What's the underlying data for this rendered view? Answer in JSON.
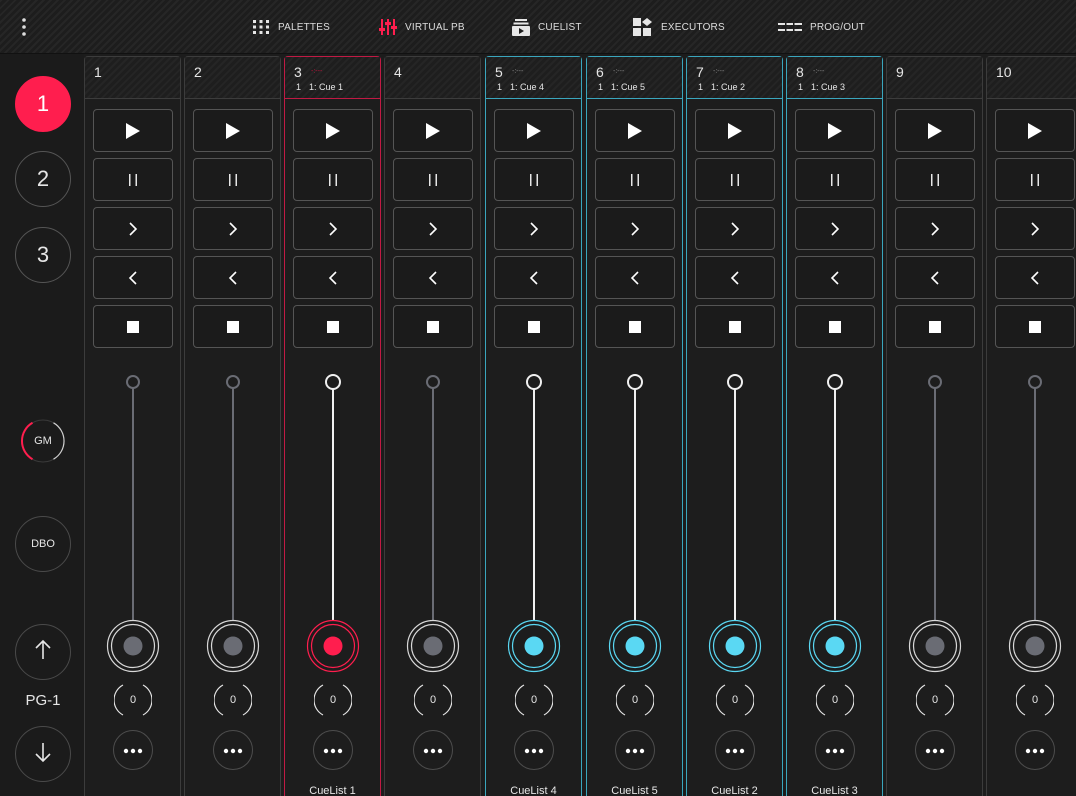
{
  "colors": {
    "accent_red": "#ff1e4e",
    "accent_blue": "#5ad8f3",
    "border_red": "#c11a44",
    "border_blue": "#3aa6bd",
    "idle_grey": "#6a6c74"
  },
  "topbar": {
    "menu_icon": "kebab-menu-icon",
    "nav": [
      {
        "label": "PALETTES",
        "icon": "grid-dots-icon"
      },
      {
        "label": "VIRTUAL PB",
        "icon": "faders-icon"
      },
      {
        "label": "CUELIST",
        "icon": "cuelist-icon"
      },
      {
        "label": "EXECUTORS",
        "icon": "executors-icon"
      },
      {
        "label": "PROG/OUT",
        "icon": "prog-out-icon"
      }
    ]
  },
  "sidebar": {
    "pages": [
      "1",
      "2",
      "3"
    ],
    "active_page": "1",
    "gm_label": "GM",
    "gm_level": 0.45,
    "dbo_label": "DBO",
    "page_label": "PG-1",
    "up_icon": "arrow-up-icon",
    "down_icon": "arrow-down-icon"
  },
  "playbacks": [
    {
      "num": "1",
      "dash": "",
      "idx": "",
      "cue": "",
      "footer": "",
      "state": "idle",
      "level": "0"
    },
    {
      "num": "2",
      "dash": "",
      "idx": "",
      "cue": "",
      "footer": "",
      "state": "idle",
      "level": "0"
    },
    {
      "num": "3",
      "dash": "-:---",
      "idx": "1",
      "cue": "1: Cue 1",
      "footer": "CueList 1",
      "state": "red",
      "level": "0"
    },
    {
      "num": "4",
      "dash": "",
      "idx": "",
      "cue": "",
      "footer": "",
      "state": "idle",
      "level": "0"
    },
    {
      "num": "5",
      "dash": "-:---",
      "idx": "1",
      "cue": "1: Cue 4",
      "footer": "CueList 4",
      "state": "blue",
      "level": "0"
    },
    {
      "num": "6",
      "dash": "-:---",
      "idx": "1",
      "cue": "1: Cue 5",
      "footer": "CueList 5",
      "state": "blue",
      "level": "0"
    },
    {
      "num": "7",
      "dash": "-:---",
      "idx": "1",
      "cue": "1: Cue 2",
      "footer": "CueList 2",
      "state": "blue",
      "level": "0"
    },
    {
      "num": "8",
      "dash": "-:---",
      "idx": "1",
      "cue": "1: Cue 3",
      "footer": "CueList 3",
      "state": "blue",
      "level": "0"
    },
    {
      "num": "9",
      "dash": "",
      "idx": "",
      "cue": "",
      "footer": "",
      "state": "idle",
      "level": "0"
    },
    {
      "num": "10",
      "dash": "",
      "idx": "",
      "cue": "",
      "footer": "",
      "state": "idle",
      "level": "0"
    }
  ],
  "button_icons": [
    "play-icon",
    "pause-icon",
    "next-icon",
    "previous-icon",
    "stop-icon",
    "more-dots-icon"
  ]
}
